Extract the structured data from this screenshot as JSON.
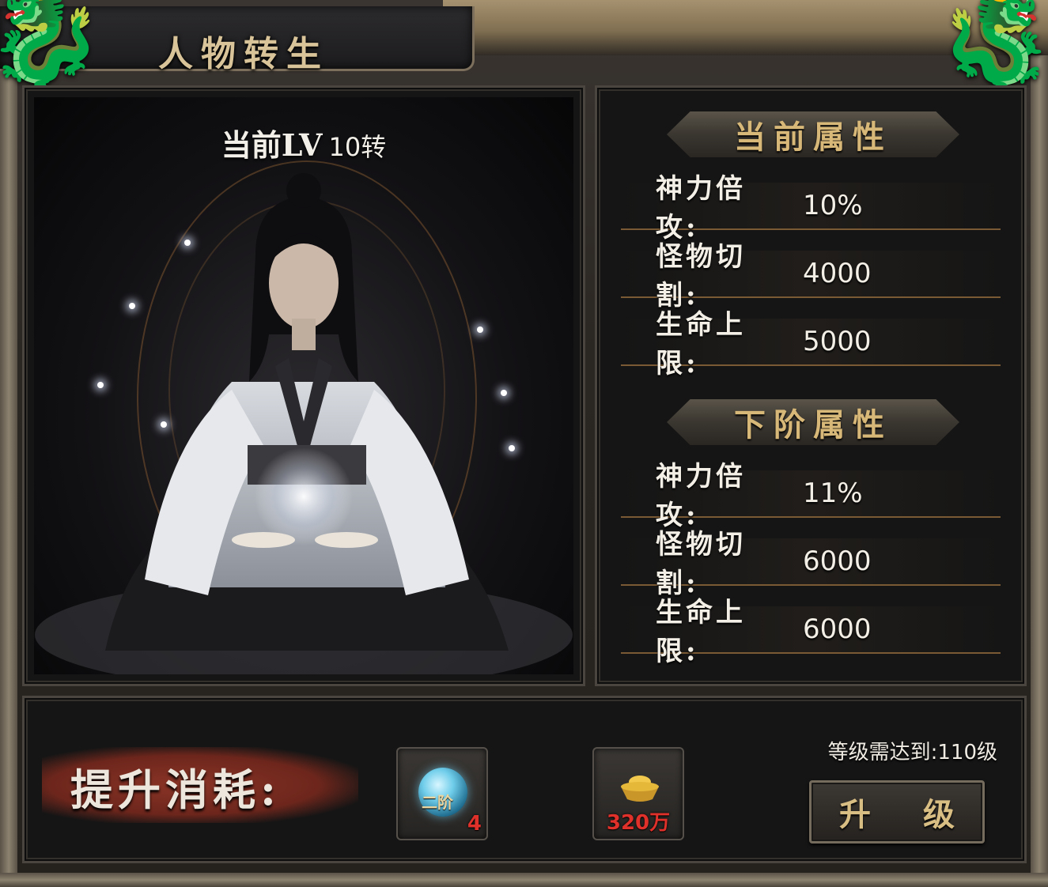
{
  "window": {
    "title": "人物转生"
  },
  "portrait": {
    "lv_label": "当前LV",
    "lv_value": "10转"
  },
  "current_attributes": {
    "heading": "当前属性",
    "items": [
      {
        "name": "神力倍攻:",
        "value": "10%"
      },
      {
        "name": "怪物切割:",
        "value": "4000"
      },
      {
        "name": "生命上限:",
        "value": "5000"
      }
    ]
  },
  "next_attributes": {
    "heading": "下阶属性",
    "items": [
      {
        "name": "神力倍攻:",
        "value": "11%"
      },
      {
        "name": "怪物切割:",
        "value": "6000"
      },
      {
        "name": "生命上限:",
        "value": "6000"
      }
    ]
  },
  "cost": {
    "label": "提升消耗:",
    "items": [
      {
        "icon": "crystal-orb-icon",
        "orb_text": "二阶",
        "quantity": "4"
      },
      {
        "icon": "gold-ingot-icon",
        "quantity": "320万"
      }
    ]
  },
  "requirement": "等级需达到:110级",
  "upgrade_button": "升 级",
  "colors": {
    "accent_gold": "#d8b878",
    "quantity_red": "#e0302a",
    "brush_red": "#8a3426"
  }
}
